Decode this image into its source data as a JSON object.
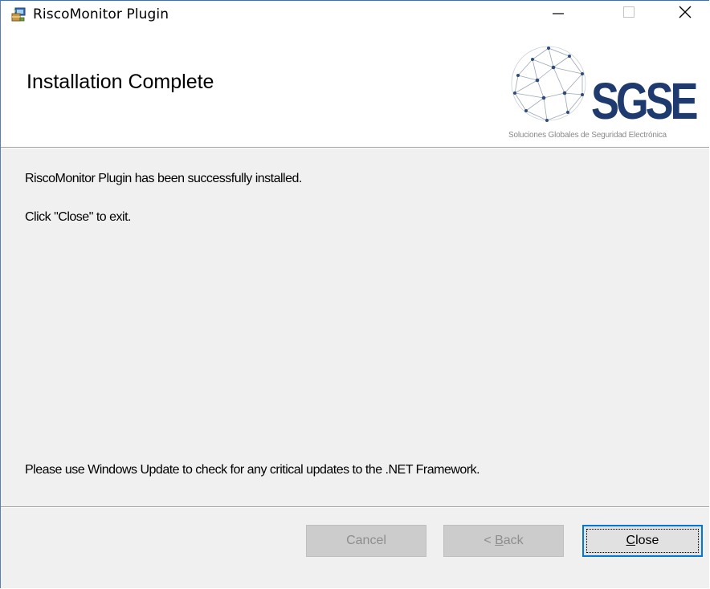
{
  "window": {
    "title": "RiscoMonitor Plugin",
    "icon": "installer-package-icon"
  },
  "titlebar": {
    "minimize_icon": "minimize-icon",
    "maximize_icon": "maximize-icon",
    "close_icon": "close-icon"
  },
  "banner": {
    "title": "Installation Complete",
    "logo_text": "SGSE",
    "logo_caption": "Soluciones Globales de Seguridad Electrónica"
  },
  "body": {
    "success_message": "RiscoMonitor Plugin has been successfully installed.",
    "exit_instruction": "Click \"Close\" to exit.",
    "update_notice": "Please use Windows Update to check for any critical updates to the .NET Framework."
  },
  "buttons": {
    "cancel_label": "Cancel",
    "back_prefix": "< ",
    "back_hotkey": "B",
    "back_rest": "ack",
    "close_hotkey": "C",
    "close_rest": "lose"
  },
  "colors": {
    "accent": "#0078d7",
    "logo_navy": "#1f3a6e",
    "dialog_bg": "#f0f0f0"
  }
}
